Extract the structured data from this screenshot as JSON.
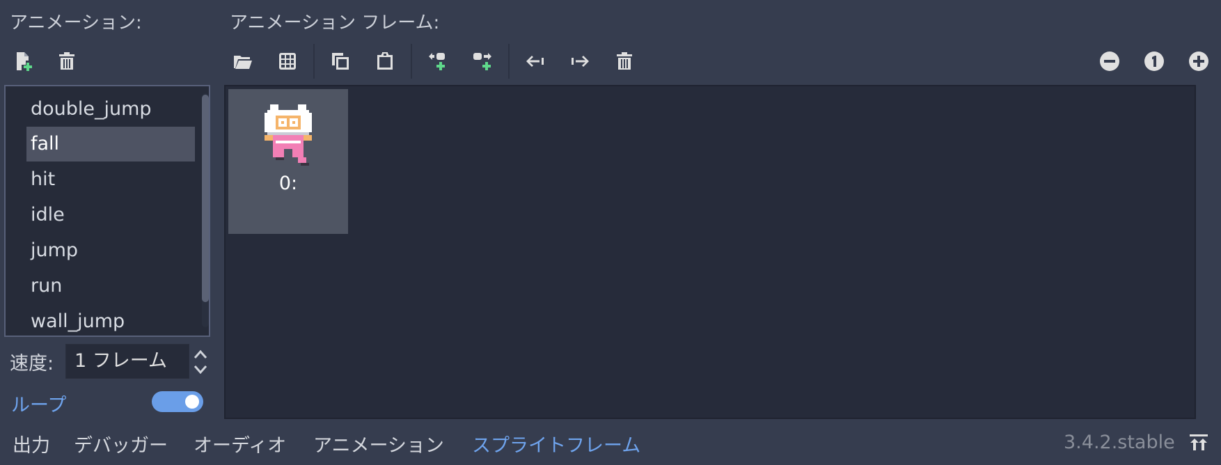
{
  "animations_panel": {
    "title": "アニメーション:",
    "items": [
      {
        "label": "double_jump"
      },
      {
        "label": "fall"
      },
      {
        "label": "hit"
      },
      {
        "label": "idle"
      },
      {
        "label": "jump"
      },
      {
        "label": "run"
      },
      {
        "label": "wall_jump"
      }
    ],
    "selected_index": 1
  },
  "frames_panel": {
    "title": "アニメーション フレーム:",
    "frames": [
      {
        "label": "0:"
      }
    ]
  },
  "speed": {
    "label": "速度:",
    "value": "1 フレーム"
  },
  "loop": {
    "label": "ループ",
    "enabled": true
  },
  "toolbar": {
    "icons": [
      "new-animation-icon",
      "delete-animation-icon",
      "load-frames-icon",
      "sprite-sheet-icon",
      "copy-icon",
      "paste-icon",
      "insert-before-icon",
      "insert-after-icon",
      "move-left-icon",
      "move-right-icon",
      "delete-frame-icon",
      "zoom-out-icon",
      "zoom-reset-icon",
      "zoom-in-icon"
    ]
  },
  "bottom_tabs": [
    {
      "label": "出力"
    },
    {
      "label": "デバッガー"
    },
    {
      "label": "オーディオ"
    },
    {
      "label": "アニメーション"
    },
    {
      "label": "スプライトフレーム",
      "active": true
    }
  ],
  "version": "3.4.2.stable",
  "colors": {
    "accent": "#6fa4ee",
    "add_green": "#5fd88b",
    "panel_bg": "#363d4f",
    "list_bg": "#262b39",
    "selected_bg": "#4e5363"
  }
}
